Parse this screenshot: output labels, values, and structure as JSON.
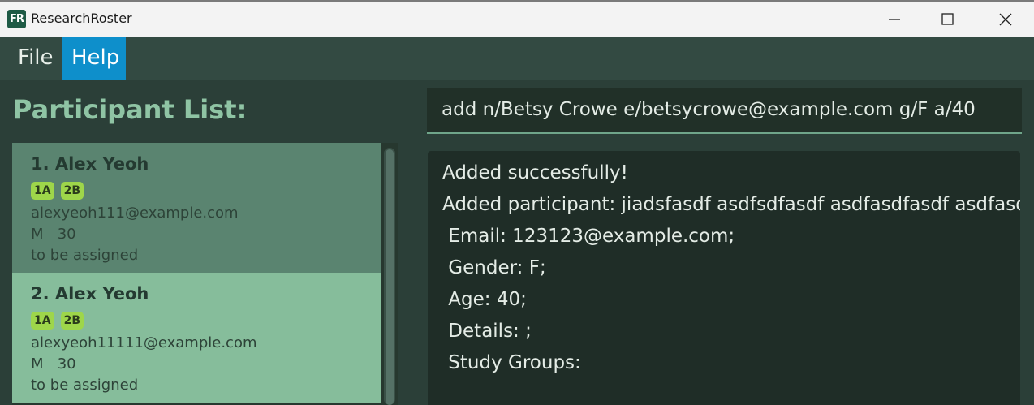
{
  "window": {
    "icon_text": "FR",
    "title": "ResearchRoster"
  },
  "menu": {
    "items": [
      {
        "label": "File"
      },
      {
        "label": "Help"
      }
    ]
  },
  "participant_list": {
    "title": "Participant List:",
    "participants": [
      {
        "name": "1. Alex Yeoh",
        "tags": [
          "1A",
          "2B"
        ],
        "email": "alexyeoh111@example.com",
        "gender_age": "M   30",
        "status": "to be assigned"
      },
      {
        "name": "2. Alex Yeoh",
        "tags": [
          "1A",
          "2B"
        ],
        "email": "alexyeoh11111@example.com",
        "gender_age": "M   30",
        "status": "to be assigned"
      }
    ]
  },
  "command": {
    "value": "add n/Betsy Crowe e/betsycrowe@example.com g/F a/40"
  },
  "result": {
    "lines": [
      "Added successfully!",
      "Added participant: jiadsfasdf asdfsdfasdf asdfasdfasdf asdfasdfasd",
      " Email: 123123@example.com;",
      " Gender: F;",
      " Age: 40;",
      " Details: ;",
      " Study Groups:"
    ]
  },
  "colors": {
    "menu_active": "#0e8fcb",
    "card_selected": "#5a8470",
    "card_default": "#86bd9b",
    "tag": "#9ed64a"
  }
}
